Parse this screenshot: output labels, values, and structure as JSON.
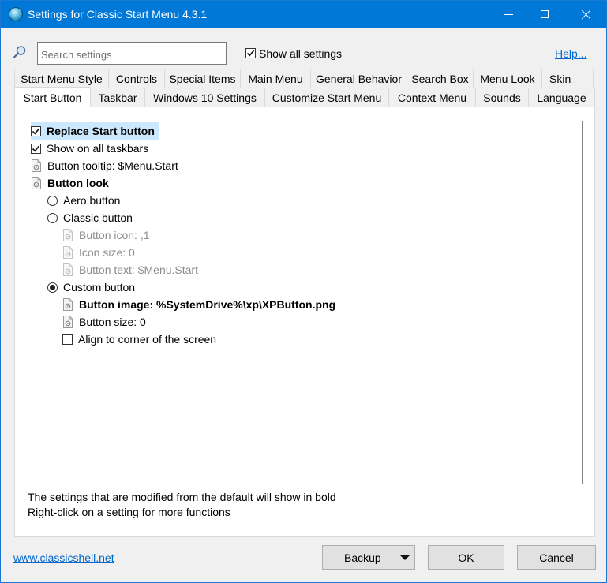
{
  "window": {
    "title": "Settings for Classic Start Menu 4.3.1"
  },
  "search": {
    "placeholder": "Search settings",
    "value": ""
  },
  "show_all": {
    "label": "Show all settings",
    "checked": true
  },
  "help_link": "Help...",
  "tabs_row1": [
    "Start Menu Style",
    "Controls",
    "Special Items",
    "Main Menu",
    "General Behavior",
    "Search Box",
    "Menu Look",
    "Skin"
  ],
  "tabs_row2": [
    "Start Button",
    "Taskbar",
    "Windows 10 Settings",
    "Customize Start Menu",
    "Context Menu",
    "Sounds",
    "Language"
  ],
  "active_tab": "Start Button",
  "settings": [
    {
      "type": "checkbox",
      "checked": true,
      "label": "Replace Start button",
      "bold": true,
      "selected": true
    },
    {
      "type": "checkbox",
      "checked": true,
      "label": "Show on all taskbars"
    },
    {
      "type": "value",
      "label": "Button tooltip: $Menu.Start"
    },
    {
      "type": "value",
      "label": "Button look",
      "bold": true
    },
    {
      "type": "radio",
      "checked": false,
      "label": "Aero button"
    },
    {
      "type": "radio",
      "checked": false,
      "label": "Classic button"
    },
    {
      "type": "value",
      "label": "Button icon: ,1",
      "disabled": true
    },
    {
      "type": "value",
      "label": "Icon size: 0",
      "disabled": true
    },
    {
      "type": "value",
      "label": "Button text: $Menu.Start",
      "disabled": true
    },
    {
      "type": "radio",
      "checked": true,
      "label": "Custom button"
    },
    {
      "type": "value",
      "label": "Button image: %SystemDrive%\\xp\\XPButton.png",
      "bold": true
    },
    {
      "type": "value",
      "label": "Button size: 0"
    },
    {
      "type": "checkbox",
      "checked": false,
      "label": "Align to corner of the screen"
    }
  ],
  "hints": [
    "The settings that are modified from the default will show in bold",
    "Right-click on a setting for more functions"
  ],
  "footer": {
    "website": "www.classicshell.net",
    "backup_label": "Backup",
    "ok_label": "OK",
    "cancel_label": "Cancel"
  },
  "colors": {
    "titlebar": "#0078d7",
    "selection": "#cce8ff",
    "link": "#0066cc"
  }
}
